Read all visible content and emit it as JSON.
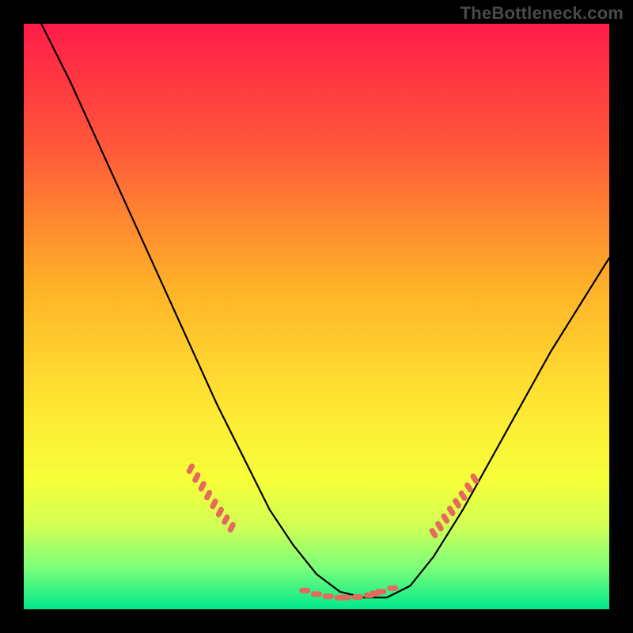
{
  "watermark": "TheBottleneck.com",
  "colors": {
    "page_bg": "#000000",
    "curve": "#000000",
    "tick_marker": "#E46A5E",
    "gradient_stops": [
      {
        "offset": 0.0,
        "color": "#FF1C49"
      },
      {
        "offset": 0.2,
        "color": "#FF553A"
      },
      {
        "offset": 0.45,
        "color": "#FFB228"
      },
      {
        "offset": 0.65,
        "color": "#FFE633"
      },
      {
        "offset": 0.78,
        "color": "#F7FF3A"
      },
      {
        "offset": 0.86,
        "color": "#CFFF55"
      },
      {
        "offset": 0.93,
        "color": "#7AFF7A"
      },
      {
        "offset": 1.0,
        "color": "#00E88B"
      }
    ]
  },
  "chart_data": {
    "type": "line",
    "title": "",
    "xlabel": "",
    "ylabel": "",
    "xlim": [
      0,
      100
    ],
    "ylim": [
      0,
      100
    ],
    "grid": false,
    "legend": false,
    "series": [
      {
        "name": "bottleneck-curve",
        "x": [
          3,
          8,
          13,
          18,
          23,
          28,
          33,
          38,
          42,
          46,
          50,
          54,
          58,
          62,
          66,
          70,
          75,
          80,
          85,
          90,
          95,
          100
        ],
        "y": [
          100,
          90,
          79,
          68,
          57,
          46,
          35,
          25,
          17,
          11,
          6,
          3,
          2,
          2,
          4,
          9,
          17,
          26,
          35,
          44,
          52,
          60
        ]
      }
    ],
    "markers_left": {
      "x": [
        28.5,
        29.5,
        30.5,
        31.5,
        32.5,
        33.5,
        34.5,
        35.5
      ],
      "y": [
        24.0,
        22.5,
        21.0,
        19.5,
        18.0,
        16.6,
        15.3,
        14.0
      ]
    },
    "markers_bottom": {
      "x": [
        48,
        50,
        52,
        54,
        55,
        57,
        59,
        60,
        61,
        63
      ],
      "y": [
        3.2,
        2.6,
        2.2,
        2.0,
        2.0,
        2.1,
        2.4,
        2.7,
        3.0,
        3.6
      ]
    },
    "markers_right": {
      "x": [
        70,
        71,
        72,
        73,
        74,
        75,
        76,
        77
      ],
      "y": [
        13.0,
        14.2,
        15.5,
        16.8,
        18.1,
        19.4,
        20.8,
        22.3
      ]
    }
  }
}
